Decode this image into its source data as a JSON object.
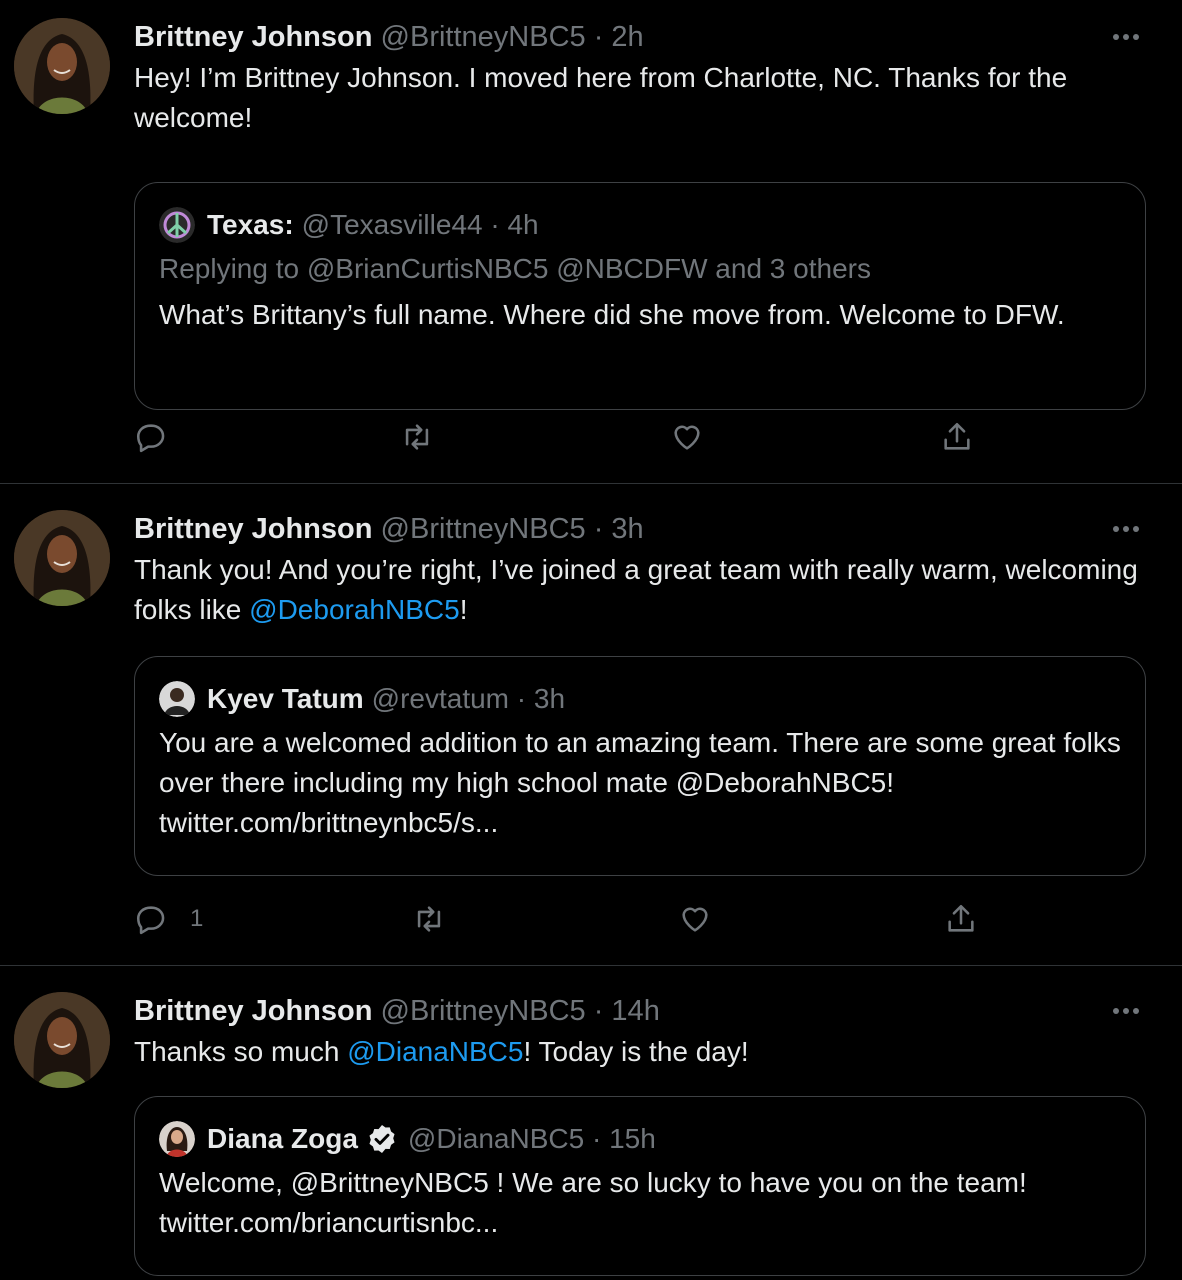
{
  "tweets": [
    {
      "author": "Brittney Johnson",
      "handle": "@BrittneyNBC5",
      "time": "· 2h",
      "text_parts": [
        "Hey! I’m Brittney Johnson. I moved here from Charlotte, NC. Thanks for the welcome!"
      ],
      "quote": {
        "author": "Texas:",
        "handle": "@Texasville44",
        "time": "· 4h",
        "replying": "Replying to @BrianCurtisNBC5 @NBCDFW and 3 others",
        "text": "What’s Brittany’s full name. Where did she move from. Welcome to DFW."
      },
      "reply_count": ""
    },
    {
      "author": "Brittney Johnson",
      "handle": "@BrittneyNBC5",
      "time": "· 3h",
      "text_before": "Thank you! And you’re right, I’ve joined a great team with really warm, welcoming folks like ",
      "mention": "@DeborahNBC5",
      "text_after": "!",
      "quote": {
        "author": "Kyev Tatum",
        "handle": "@revtatum",
        "time": "· 3h",
        "text": "You are a welcomed addition to an amazing team. There are some great folks over there including my high school mate @DeborahNBC5! twitter.com/brittneynbc5/s..."
      },
      "reply_count": "1"
    },
    {
      "author": "Brittney Johnson",
      "handle": "@BrittneyNBC5",
      "time": "· 14h",
      "text_before": "Thanks so much ",
      "mention": "@DianaNBC5",
      "text_after": "! Today is the day!",
      "quote": {
        "author": "Diana Zoga",
        "handle": "@DianaNBC5",
        "time": "· 15h",
        "text": "Welcome, @BrittneyNBC5 ! We are so lucky to have you on the team! twitter.com/briancurtisnbc..."
      }
    }
  ],
  "icons": [
    "reply-icon",
    "retweet-icon",
    "like-icon",
    "share-icon",
    "more-icon",
    "verified-icon"
  ],
  "colors": {
    "background": "#000000",
    "text": "#e7e9ea",
    "muted": "#71767b",
    "link": "#1d9bf0",
    "border": "#2f3336"
  }
}
